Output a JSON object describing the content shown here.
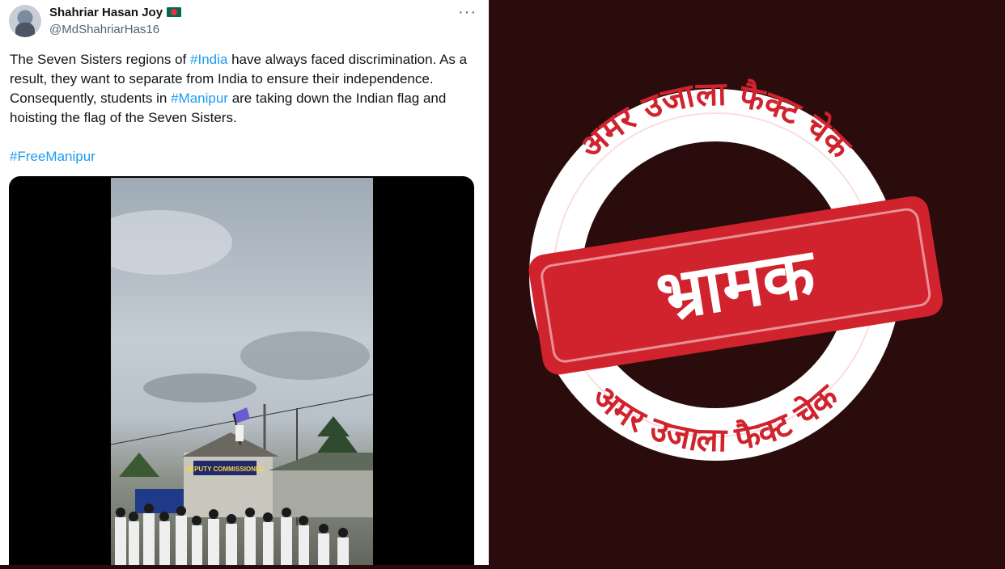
{
  "tweet": {
    "name": "Shahriar Hasan Joy",
    "handle": "@MdShahriarHas16",
    "more": "···",
    "text": {
      "seg1": "The Seven Sisters regions of ",
      "tag1": "#India",
      "seg2": " have always faced discrimination. As a result, they want to separate from India to ensure their independence. Consequently, students in ",
      "tag2": "#Manipur",
      "seg3": " are taking down the Indian flag and hoisting the flag of the Seven Sisters."
    },
    "hashtag": "#FreeManipur",
    "sign_text": "DEPUTY COMMISSIONER"
  },
  "stamp": {
    "arc_text_top": "अमर उजाला फैक्ट चेक",
    "arc_text_bottom": "अमर उजाला फैक्ट चेक",
    "verdict": "भ्रामक",
    "colors": {
      "red": "#d0232d",
      "ring": "#ffffff",
      "background": "#2a0c0c"
    }
  }
}
